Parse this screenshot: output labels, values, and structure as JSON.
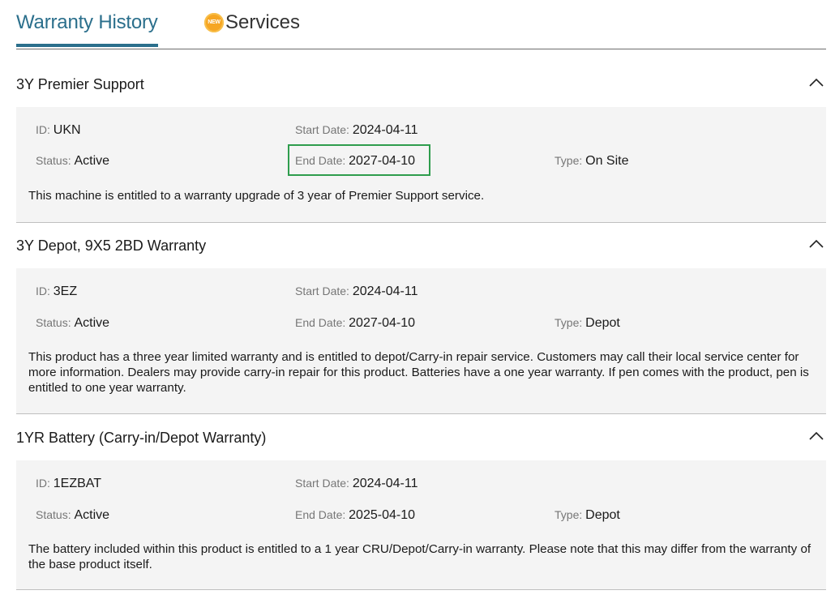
{
  "tabs": [
    {
      "label": "Warranty History",
      "active": true
    },
    {
      "label": "Services",
      "badge": "NEW"
    }
  ],
  "field_labels": {
    "id": "ID",
    "start_date": "Start Date",
    "end_date": "End Date",
    "status": "Status",
    "type": "Type"
  },
  "warranties": [
    {
      "title": "3Y Premier Support",
      "id": "UKN",
      "start_date": "2024-04-11",
      "status": "Active",
      "end_date": "2027-04-10",
      "type": "On Site",
      "description": "This machine is entitled to a warranty upgrade of 3 year of Premier Support service.",
      "end_date_highlighted": true
    },
    {
      "title": "3Y Depot, 9X5 2BD Warranty",
      "id": "3EZ",
      "start_date": "2024-04-11",
      "status": "Active",
      "end_date": "2027-04-10",
      "type": "Depot",
      "description": "This product has a three year limited warranty and is entitled to depot/Carry-in repair service. Customers may call their local service center for more information. Dealers may provide carry-in repair for this product. Batteries have a one year warranty. If pen comes with the product, pen is entitled to one year warranty."
    },
    {
      "title": "1YR Battery (Carry-in/Depot Warranty)",
      "id": "1EZBAT",
      "start_date": "2024-04-11",
      "status": "Active",
      "end_date": "2025-04-10",
      "type": "Depot",
      "description": "The battery included within this product is entitled to a 1 year CRU/Depot/Carry-in warranty. Please note that this may differ from the warranty of the base product itself."
    }
  ],
  "colors": {
    "accent": "#2b6f8c",
    "badge": "#f6a623",
    "highlight_border": "#2e9d4d",
    "panel_bg": "#f4f4f4"
  },
  "icons": {
    "collapse": "chevron-up-icon",
    "new_badge": "new-badge-icon"
  }
}
